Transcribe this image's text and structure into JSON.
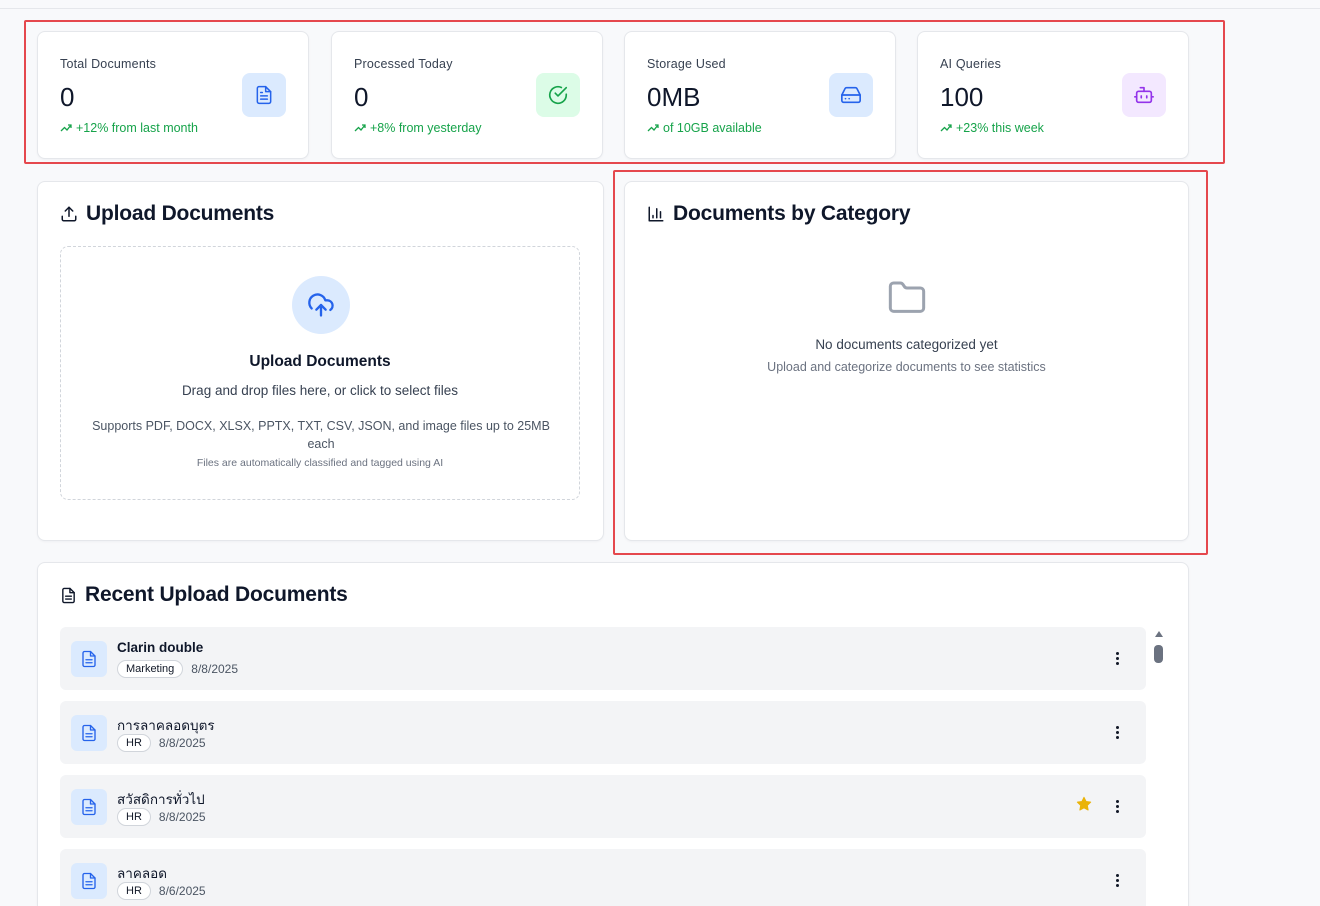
{
  "stats": [
    {
      "label": "Total Documents",
      "value": "0",
      "change": "+12% from last month",
      "icon": "document-icon",
      "icon_bg": "#dbeafe",
      "icon_color": "#2563eb"
    },
    {
      "label": "Processed Today",
      "value": "0",
      "change": "+8% from yesterday",
      "icon": "check-circle-icon",
      "icon_bg": "#dcfce7",
      "icon_color": "#16a34a"
    },
    {
      "label": "Storage Used",
      "value": "0MB",
      "change": "of 10GB available",
      "icon": "hard-drive-icon",
      "icon_bg": "#dbeafe",
      "icon_color": "#2563eb"
    },
    {
      "label": "AI Queries",
      "value": "100",
      "change": "+23% this week",
      "icon": "bot-icon",
      "icon_bg": "#f3e8ff",
      "icon_color": "#9333ea"
    }
  ],
  "upload": {
    "title": "Upload Documents",
    "dropzone_title": "Upload Documents",
    "dropzone_subtitle": "Drag and drop files here, or click to select files",
    "formats": "Supports PDF, DOCX, XLSX, PPTX, TXT, CSV, JSON, and image files up to 25MB each",
    "note": "Files are automatically classified and tagged using AI"
  },
  "category": {
    "title": "Documents by Category",
    "empty_title": "No documents categorized yet",
    "empty_subtitle": "Upload and categorize documents to see statistics"
  },
  "recent": {
    "title": "Recent Upload Documents",
    "items": [
      {
        "name": "Clarin double",
        "tag": "Marketing",
        "date": "8/8/2025",
        "starred": false
      },
      {
        "name": "การลาคลอดบุตร",
        "tag": "HR",
        "date": "8/8/2025",
        "starred": false
      },
      {
        "name": "สวัสดิการทั่วไป",
        "tag": "HR",
        "date": "8/8/2025",
        "starred": true
      },
      {
        "name": "ลาคลอด",
        "tag": "HR",
        "date": "8/6/2025",
        "starred": false
      }
    ]
  },
  "colors": {
    "accent": "#2563eb",
    "positive": "#16a34a",
    "highlight": "#e5484d",
    "star": "#eab308"
  }
}
